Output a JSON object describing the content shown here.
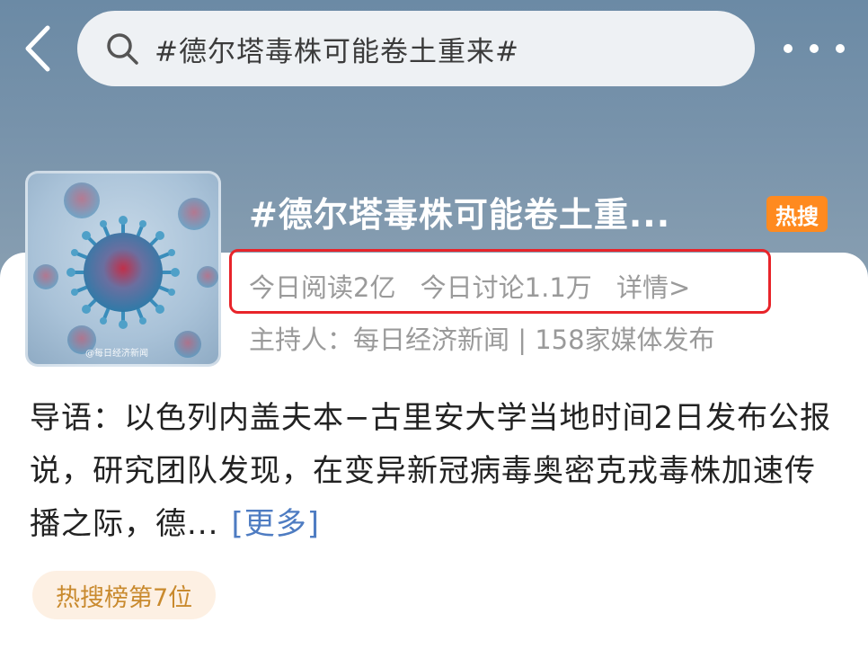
{
  "search": {
    "query": "#德尔塔毒株可能卷土重来#"
  },
  "topic": {
    "title": "#德尔塔毒株可能卷土重...",
    "badge": "热搜",
    "image_watermark": "@每日经济新闻",
    "stats": {
      "reads": "今日阅读2亿",
      "discussions": "今日讨论1.1万",
      "details_link": "详情>"
    },
    "host_line": "主持人：每日经济新闻 | 158家媒体发布"
  },
  "intro": {
    "text": "导语：以色列内盖夫本−古里安大学当地时间2日发布公报说，研究团队发现，在变异新冠病毒奥密克戎毒株加速传播之际，德...",
    "more_label": "[更多]"
  },
  "rank": {
    "label": "热搜榜第7位"
  },
  "colors": {
    "header_bg": "#7893ab",
    "highlight_border": "#e8242a",
    "badge": "#ff8a1f",
    "link": "#4e7cc2",
    "rank_text": "#c98a2e",
    "rank_bg": "#fdf0e3"
  },
  "icons": {
    "back": "chevron-left-icon",
    "search": "search-icon",
    "more": "more-dots-icon"
  }
}
